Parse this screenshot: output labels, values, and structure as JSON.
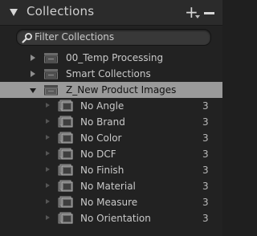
{
  "panel": {
    "title": "Collections",
    "add_symbol": "+",
    "filter_placeholder": "Filter Collections"
  },
  "collection_sets": [
    {
      "label": "00_Temp Processing",
      "expanded": false,
      "selected": false
    },
    {
      "label": "Smart Collections",
      "expanded": false,
      "selected": false
    },
    {
      "label": "Z_New Product Images",
      "expanded": true,
      "selected": true
    }
  ],
  "collections": [
    {
      "label": "No Angle",
      "count": "3"
    },
    {
      "label": "No Brand",
      "count": "3"
    },
    {
      "label": "No Color",
      "count": "3"
    },
    {
      "label": "No DCF",
      "count": "3"
    },
    {
      "label": "No Finish",
      "count": "3"
    },
    {
      "label": "No Material",
      "count": "3"
    },
    {
      "label": "No Measure",
      "count": "3"
    },
    {
      "label": "No Orientation",
      "count": "3"
    }
  ],
  "colors": {
    "panel_bg": "#222222",
    "header_bg": "#2b2b2b",
    "selected_row": "#9a9a9a",
    "text": "#c9c9c9"
  }
}
